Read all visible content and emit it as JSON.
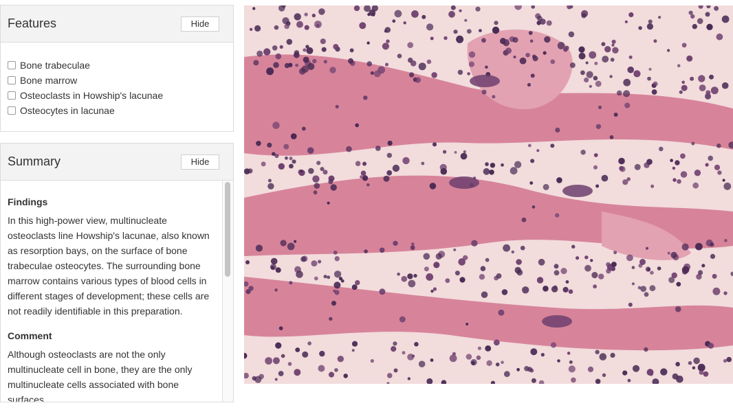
{
  "features": {
    "title": "Features",
    "hide_label": "Hide",
    "items": [
      {
        "label": "Bone trabeculae",
        "checked": false
      },
      {
        "label": "Bone marrow",
        "checked": false
      },
      {
        "label": "Osteoclasts in Howship's lacunae",
        "checked": false
      },
      {
        "label": "Osteocytes in lacunae",
        "checked": false
      }
    ]
  },
  "summary": {
    "title": "Summary",
    "hide_label": "Hide",
    "findings_heading": "Findings",
    "findings_text": "In this high-power view, multinucleate osteoclasts line Howship's lacunae, also known as resorption bays, on the surface of bone trabeculae osteocytes. The surrounding bone marrow contains various types of blood cells in different stages of development; these cells are not readily identifiable in this preparation.",
    "comment_heading": "Comment",
    "comment_text": "Although osteoclasts are not the only multinucleate cell in bone, they are the only multinucleate cells associated with bone surfaces."
  },
  "micrograph": {
    "colors": {
      "background": "#d9a7b6",
      "marrow_space": "#f2dcdc",
      "bone_matrix": "#d7849a",
      "bone_matrix_light": "#e3a2b2",
      "nucleus_dark": "#4b2a55",
      "nucleus_mid": "#6e3f6e"
    }
  }
}
